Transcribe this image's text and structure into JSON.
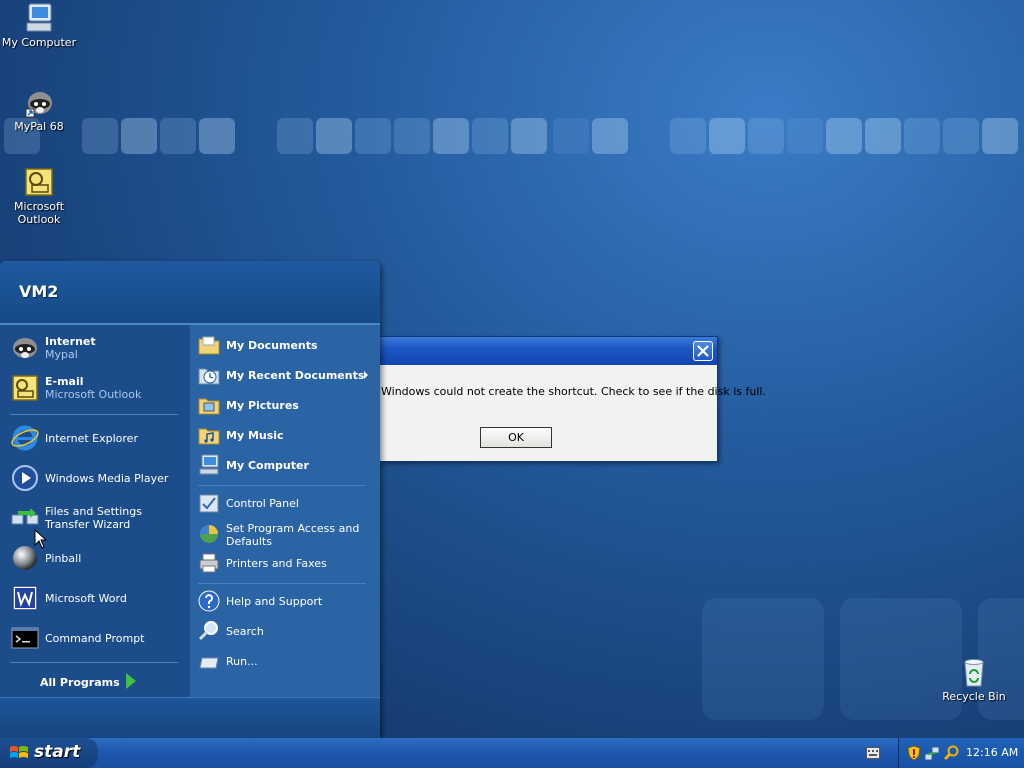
{
  "desktop": {
    "icons": [
      {
        "label": "My Computer"
      },
      {
        "label": "MyPal 68"
      },
      {
        "label": "Microsoft Outlook"
      },
      {
        "label": "Recycle Bin"
      }
    ]
  },
  "start_menu": {
    "user_name": "VM2",
    "pinned": [
      {
        "title": "Internet",
        "subtitle": "Mypal"
      },
      {
        "title": "E-mail",
        "subtitle": "Microsoft Outlook"
      }
    ],
    "recent": [
      {
        "label": "Internet Explorer"
      },
      {
        "label": "Windows Media Player"
      },
      {
        "label": "Files and Settings Transfer Wizard"
      },
      {
        "label": "Pinball"
      },
      {
        "label": "Microsoft Word"
      },
      {
        "label": "Command Prompt"
      }
    ],
    "all_programs": "All Programs",
    "right": {
      "places": [
        {
          "label": "My Documents"
        },
        {
          "label": "My Recent Documents"
        },
        {
          "label": "My Pictures"
        },
        {
          "label": "My Music"
        },
        {
          "label": "My Computer"
        }
      ],
      "settings": [
        {
          "label": "Control Panel"
        },
        {
          "label": "Set Program Access and Defaults"
        },
        {
          "label": "Printers and Faxes"
        }
      ],
      "tools": [
        {
          "label": "Help and Support"
        },
        {
          "label": "Search"
        },
        {
          "label": "Run..."
        }
      ]
    }
  },
  "dialog": {
    "message": "Windows could not create the shortcut. Check to see if the disk is full.",
    "ok_label": "OK"
  },
  "taskbar": {
    "start_label": "start",
    "clock": "12:16 AM"
  },
  "colors": {
    "desktop": "#23599b",
    "start_menu_left": "#1c4c89",
    "start_menu_right": "#2b64a4",
    "taskbar": "#1e56ad",
    "dialog_title": "#1c56c4"
  }
}
